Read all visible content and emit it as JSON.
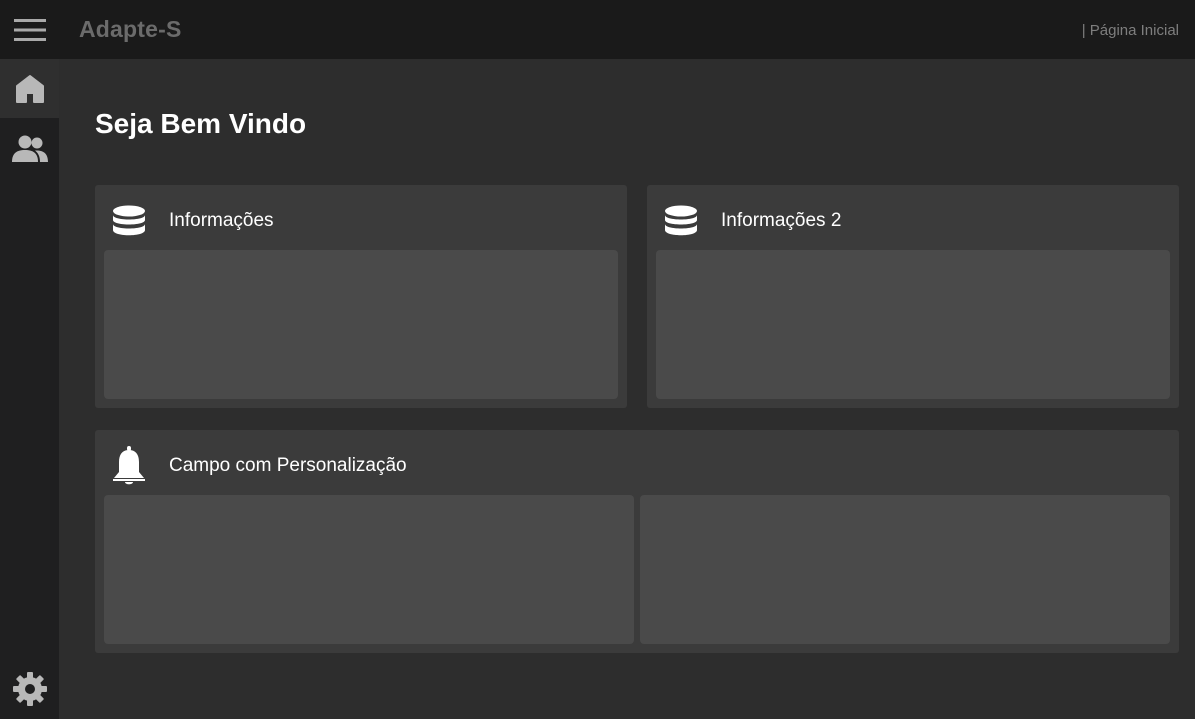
{
  "app": {
    "title": "Adapte-S",
    "breadcrumb": "| Página Inicial"
  },
  "sidebar": {
    "items": [
      {
        "icon": "home-icon",
        "active": true
      },
      {
        "icon": "users-icon",
        "active": false
      }
    ],
    "footer_icon": "gear-icon"
  },
  "main": {
    "welcome": "Seja Bem Vindo",
    "cards": [
      {
        "title": "Informações",
        "icon": "database-icon"
      },
      {
        "title": "Informações 2",
        "icon": "database-icon"
      },
      {
        "title": "Campo com Personalização",
        "icon": "bell-icon"
      }
    ]
  },
  "colors": {
    "background": "#2d2d2d",
    "sidebar": "#1f1f20",
    "topbar": "#1a1a1a",
    "card": "#3b3b3b",
    "panel": "#4a4a4a",
    "icon_muted": "#b8b8b8",
    "text": "#ffffff"
  }
}
